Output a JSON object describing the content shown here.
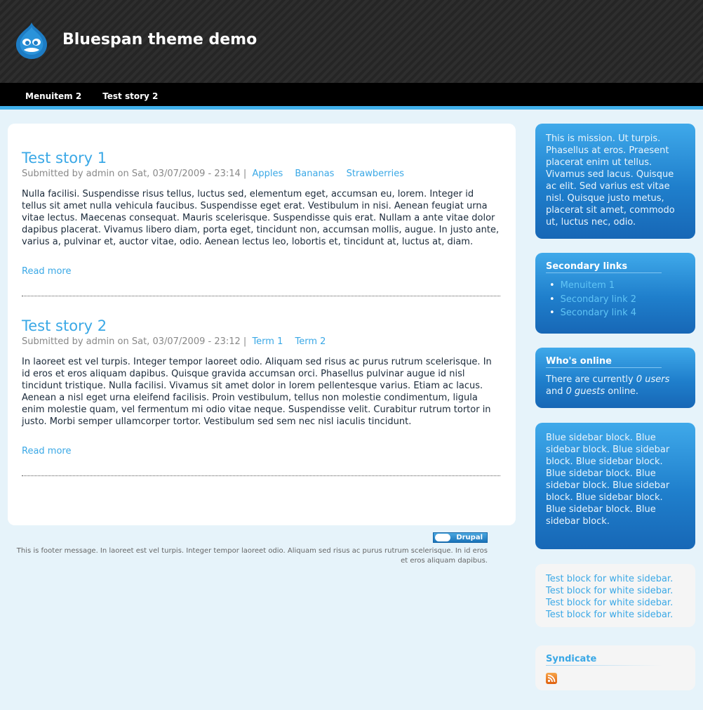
{
  "site": {
    "name": "Bluespan theme demo"
  },
  "nav": {
    "items": [
      "Menuitem 2",
      "Test story 2"
    ]
  },
  "nodes": [
    {
      "title": "Test story 1",
      "submitted": "Submitted by admin on Sat, 03/07/2009 - 23:14 |",
      "terms": [
        "Apples",
        "Bananas",
        "Strawberries"
      ],
      "body": "Nulla facilisi. Suspendisse risus tellus, luctus sed, elementum eget, accumsan eu, lorem. Integer id tellus sit amet nulla vehicula faucibus. Suspendisse eget erat. Vestibulum in nisi. Aenean feugiat urna vitae lectus. Maecenas consequat. Mauris scelerisque. Suspendisse quis erat. Nullam a ante vitae dolor dapibus placerat. Vivamus libero diam, porta eget, tincidunt non, accumsan mollis, augue. In justo ante, varius a, pulvinar et, auctor vitae, odio. Aenean lectus leo, lobortis et, tincidunt at, luctus at, diam.",
      "read_more": "Read more"
    },
    {
      "title": "Test story 2",
      "submitted": "Submitted by admin on Sat, 03/07/2009 - 23:12 |",
      "terms": [
        "Term 1",
        "Term 2"
      ],
      "body": "In laoreet est vel turpis. Integer tempor laoreet odio. Aliquam sed risus ac purus rutrum scelerisque. In id eros et eros aliquam dapibus. Quisque gravida accumsan orci. Phasellus pulvinar augue id nisl tincidunt tristique. Nulla facilisi. Vivamus sit amet dolor in lorem pellentesque varius. Etiam ac lacus. Aenean a nisl eget urna eleifend facilisis. Proin vestibulum, tellus non molestie condimentum, ligula enim molestie quam, vel fermentum mi odio vitae neque. Suspendisse velit. Curabitur rutrum tortor in justo. Morbi semper ullamcorper tortor. Vestibulum sed sem nec nisl iaculis tincidunt.",
      "read_more": "Read more"
    }
  ],
  "footer": {
    "badge": "Drupal",
    "message": "This is footer message. In laoreet est vel turpis. Integer tempor laoreet odio. Aliquam sed risus ac purus rutrum scelerisque. In id eros et eros aliquam dapibus."
  },
  "sidebar": {
    "mission": "This is mission. Ut turpis. Phasellus at eros. Praesent placerat enim ut tellus. Vivamus sed lacus. Quisque ac elit. Sed varius est vitae nisl. Quisque justo metus, placerat sit amet, commodo ut, luctus nec, odio.",
    "secondary": {
      "title": "Secondary links",
      "items": [
        "Menuitem 1",
        "Secondary link 2",
        "Secondary link 4"
      ]
    },
    "online": {
      "title": "Who's online",
      "pre": "There are currently ",
      "users": "0 users",
      "mid": "and ",
      "guests": "0 guests",
      "post": " online."
    },
    "blue_block": "Blue sidebar block. Blue sidebar block. Blue sidebar block. Blue sidebar block. Blue sidebar block. Blue sidebar block. Blue sidebar block. Blue sidebar block. Blue sidebar block. Blue sidebar block.",
    "white_block": "Test block for white sidebar. Test block for white sidebar. Test block for white sidebar. Test block for white sidebar.",
    "syndicate": {
      "title": "Syndicate",
      "icon": "rss-feed-icon"
    }
  },
  "colors": {
    "accent": "#3aa8e6",
    "nav_bar": "#000000",
    "nav_border": "#3fb0ec",
    "page_bg": "#e6f3fa"
  }
}
